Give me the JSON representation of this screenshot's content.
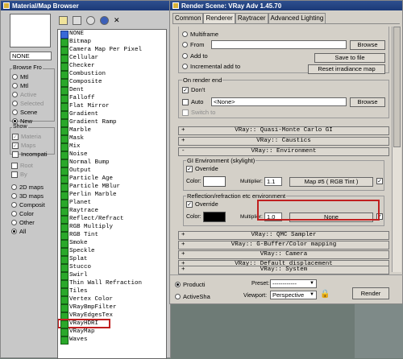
{
  "material_browser": {
    "title": "Material/Map Browser",
    "name_field": "NONE",
    "browse_from": {
      "title": "Browse Fro",
      "options": [
        "Mtl",
        "Mtl",
        "Active",
        "Selected",
        "Scene",
        "New"
      ],
      "selected_index": 5
    },
    "show": {
      "title": "Show",
      "checks": [
        {
          "label": "Materia",
          "checked": true,
          "disabled": true
        },
        {
          "label": "Maps",
          "checked": true,
          "disabled": true
        },
        {
          "label": "Incompati",
          "checked": false,
          "disabled": false
        }
      ],
      "checks2": [
        {
          "label": "Root",
          "disabled": true
        },
        {
          "label": "By",
          "disabled": true
        }
      ],
      "radios": [
        {
          "label": "2D maps",
          "on": false
        },
        {
          "label": "3D maps",
          "on": false
        },
        {
          "label": "Composit",
          "on": false
        },
        {
          "label": "Color",
          "on": false
        },
        {
          "label": "Other",
          "on": false
        },
        {
          "label": "All",
          "on": true
        }
      ]
    },
    "list": [
      "NONE",
      "Bitmap",
      "Camera Map Per Pixel",
      "Cellular",
      "Checker",
      "Combustion",
      "Composite",
      "Dent",
      "Falloff",
      "Flat Mirror",
      "Gradient",
      "Gradient Ramp",
      "Marble",
      "Mask",
      "Mix",
      "Noise",
      "Normal Bump",
      "Output",
      "Particle Age",
      "Particle MBlur",
      "Perlin Marble",
      "Planet",
      "Raytrace",
      "Reflect/Refract",
      "RGB Multiply",
      "RGB Tint",
      "Smoke",
      "Speckle",
      "Splat",
      "Stucco",
      "Swirl",
      "Thin Wall Refraction",
      "Tiles",
      "Vertex Color",
      "VRayBmpFilter",
      "VRayEdgesTex",
      "VRayHDRI",
      "VRayMap",
      "Waves"
    ],
    "selected_item": "VRayHDRI"
  },
  "render_scene": {
    "title": "Render Scene: VRay Adv 1.45.70",
    "tabs": [
      "Common",
      "Renderer",
      "Raytracer",
      "Advanced Lighting"
    ],
    "active_tab": "Renderer",
    "mode": {
      "multiframe": "Multiframe",
      "from": "From",
      "add_to": "Add to",
      "incremental": "Incremental add to",
      "browse": "Browse",
      "save_to_file": "Save to file",
      "reset": "Reset irradiance map"
    },
    "on_render_end": {
      "title": "On render end",
      "dont": "Don't",
      "auto": "Auto",
      "auto_value": "<None>",
      "browse": "Browse",
      "switch_to": "Switch to"
    },
    "rollouts_top": [
      "VRay:: Quasi-Monte Carlo GI",
      "VRay:: Caustics"
    ],
    "environment": {
      "rollout": "VRay:: Environment",
      "gi_title": "GI Environment (skylight)",
      "override": "Override",
      "color": "Color:",
      "multiplier": "Multiplier:",
      "gi_mult": "1.1",
      "gi_map": "Map #5  ( RGB Tint )",
      "refl_title": "Reflection/refraction etc environment",
      "refl_override": "Override",
      "refl_mult": "1.0",
      "refl_map": "None"
    },
    "rollouts_bottom": [
      "VRay:: QMC Sampler",
      "VRay:: G-Buffer/Color mapping",
      "VRay:: Camera",
      "VRay:: Default displacement",
      "VRay:: System"
    ],
    "bottom": {
      "production": "Producti",
      "activeshade": "ActiveSha",
      "preset_label": "Preset:",
      "preset_value": "------------",
      "viewport_label": "Viewport:",
      "viewport_value": "Perspective",
      "render": "Render"
    }
  }
}
